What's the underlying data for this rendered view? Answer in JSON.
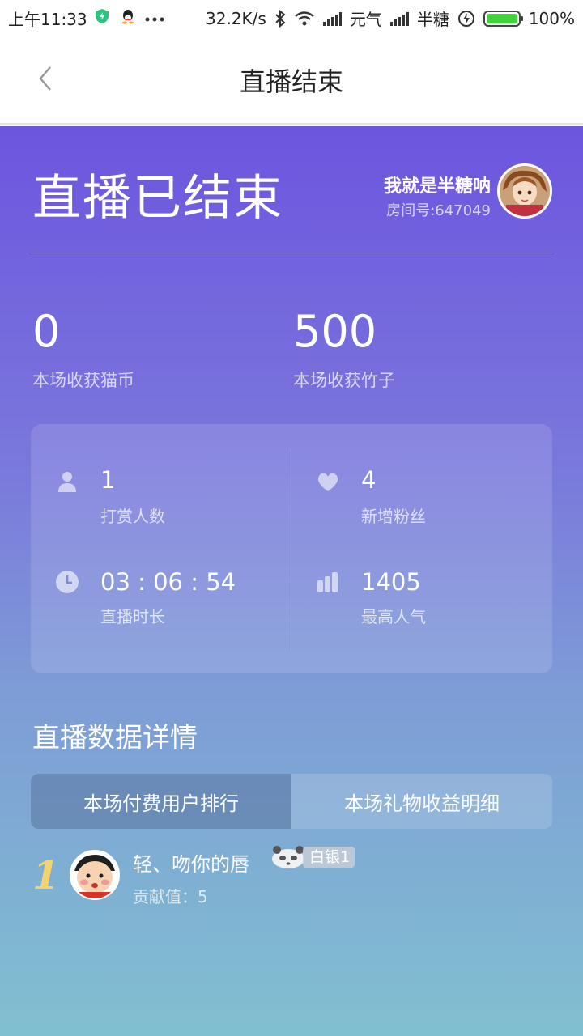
{
  "status_bar": {
    "time": "上午11:33",
    "speed": "32.2K/s",
    "carrier1": "元气",
    "carrier2": "半糖",
    "battery": "100%",
    "battery_level": 1.0,
    "icons": [
      "shield-icon",
      "qq-icon",
      "more-dots-icon",
      "bluetooth-icon",
      "wifi-icon",
      "signal-icon",
      "charging-icon",
      "battery-icon"
    ]
  },
  "header": {
    "title": "直播结束",
    "back_icon": "chevron-left-icon"
  },
  "summary": {
    "ended_title": "直播已结束",
    "host_name": "我就是半糖呐",
    "room_id": "房间号:647049"
  },
  "earnings": [
    {
      "value": "0",
      "label": "本场收获猫币"
    },
    {
      "value": "500",
      "label": "本场收获竹子"
    }
  ],
  "stats": [
    {
      "icon": "user-icon",
      "value": "1",
      "label": "打赏人数"
    },
    {
      "icon": "heart-icon",
      "value": "4",
      "label": "新增粉丝"
    },
    {
      "icon": "clock-icon",
      "value": "03 : 06 : 54",
      "label": "直播时长"
    },
    {
      "icon": "bar-chart-icon",
      "value": "1405",
      "label": "最高人气"
    }
  ],
  "details": {
    "section_title": "直播数据详情",
    "tabs": [
      {
        "label": "本场付费用户排行",
        "active": true
      },
      {
        "label": "本场礼物收益明细",
        "active": false
      }
    ]
  },
  "ranking": [
    {
      "rank": "1",
      "name": "轻、吻你的唇",
      "badge": "白银1",
      "contribution": "贡献值：5"
    }
  ],
  "colors": {
    "gradient_top": "#6d55df",
    "gradient_bottom": "#80c0d0",
    "rank_gold": "#f2d36f",
    "battery_green": "#3fd33c"
  }
}
